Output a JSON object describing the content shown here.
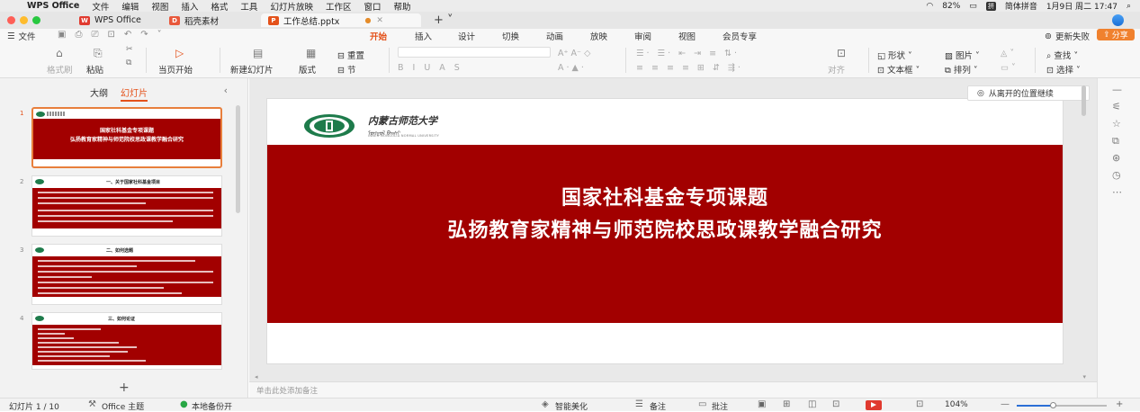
{
  "menubar": {
    "app_name": "WPS Office",
    "items": [
      "文件",
      "编辑",
      "视图",
      "插入",
      "格式",
      "工具",
      "幻灯片放映",
      "工作区",
      "窗口",
      "帮助"
    ],
    "battery": "82%",
    "input_method": "简体拼音",
    "datetime": "1月9日 周二  17:47"
  },
  "tabs": [
    {
      "label": "WPS Office",
      "color": "#e03a2f"
    },
    {
      "label": "稻壳素材",
      "color": "#e8583b"
    },
    {
      "label": "工作总结.pptx",
      "color": "#e4521b"
    }
  ],
  "ribbon": {
    "file_label": "文件",
    "tabs": [
      "开始",
      "插入",
      "设计",
      "切换",
      "动画",
      "放映",
      "审阅",
      "视图",
      "会员专享"
    ],
    "active_tab": "开始",
    "update_failed": "更新失败",
    "share": "分享"
  },
  "toolbar": {
    "format_painter": "格式刷",
    "paste": "粘贴",
    "from_current": "当页开始",
    "new_slide": "新建幻灯片",
    "layout": "版式",
    "reset": "重置",
    "section": "节",
    "align": "对齐",
    "shape": "形状",
    "picture": "图片",
    "find": "查找",
    "textbox": "文本框",
    "arrange": "排列",
    "select": "选择"
  },
  "left_panel": {
    "outline_tab": "大纲",
    "slides_tab": "幻灯片",
    "thumbnails": [
      {
        "num": "1",
        "line1": "国家社科基金专项课题",
        "line2": "弘扬教育家精神与师范院校思政课教学融合研究"
      },
      {
        "num": "2",
        "heading": "一、关于国家社科基金项目"
      },
      {
        "num": "3",
        "heading": "二、如何选题"
      },
      {
        "num": "4",
        "heading": "三、如何论证"
      }
    ]
  },
  "slide": {
    "title1": "国家社科基金专项课题",
    "title2": "弘扬教育家精神与师范院校思政课教学融合研究",
    "logo_cn": "内蒙古师范大学"
  },
  "resume_hint": "从离开的位置继续",
  "notes_placeholder": "单击此处添加备注",
  "statusbar": {
    "slide_counter": "幻灯片 1 / 10",
    "theme": "Office 主题",
    "backup": "本地备份开",
    "beautify": "智能美化",
    "notes": "备注",
    "comments": "批注",
    "zoom": "104%",
    "zoom_level": 0.4
  }
}
